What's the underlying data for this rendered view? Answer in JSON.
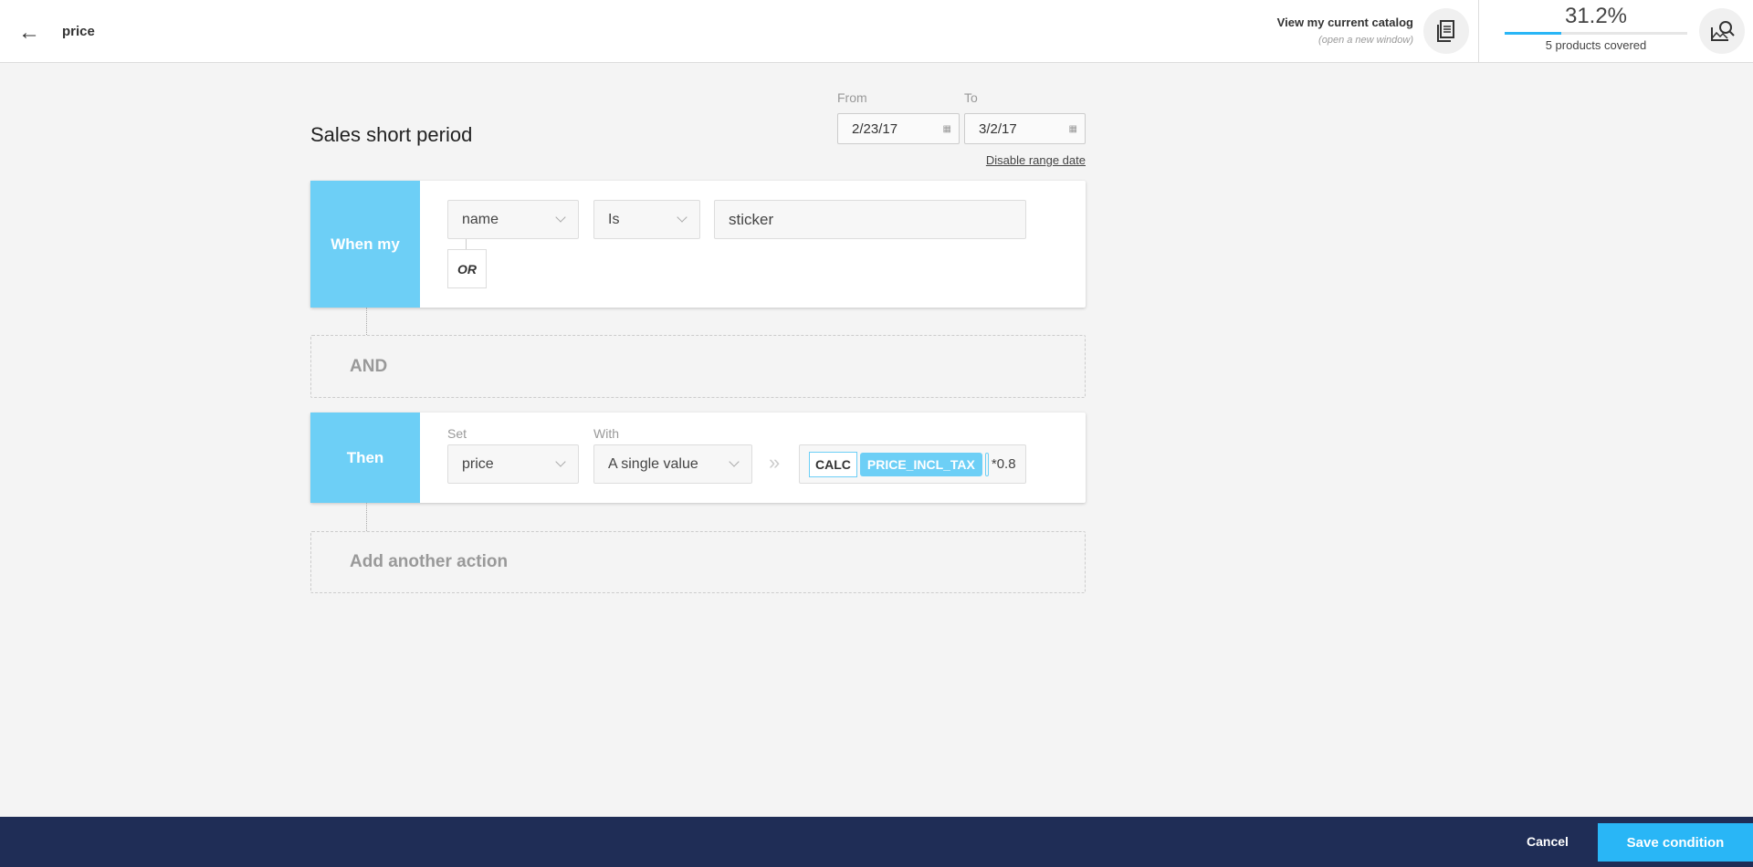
{
  "header": {
    "title": "price",
    "catalog_link": "View my current catalog",
    "catalog_sub": "(open a new window)",
    "coverage_percent": "31.2%",
    "coverage_fraction": 0.312,
    "coverage_text": "5 products covered",
    "icons": [
      "arrow-left-icon",
      "document-icon",
      "image-search-icon"
    ]
  },
  "main": {
    "title": "Sales short period",
    "from_label": "From",
    "to_label": "To",
    "from_value": "2/23/17",
    "to_value": "3/2/17",
    "disable_range": "Disable range date",
    "when": {
      "label": "When my",
      "field": "name",
      "operator": "Is",
      "value": "sticker",
      "or_label": "OR"
    },
    "and_label": "AND",
    "then": {
      "label": "Then",
      "set_label": "Set",
      "set_value": "price",
      "with_label": "With",
      "with_value": "A single value",
      "calc_tag": "CALC",
      "variable_tag": "PRICE_INCL_TAX",
      "expression": "*0.8"
    },
    "add_action": "Add another action"
  },
  "footer": {
    "cancel": "Cancel",
    "save": "Save condition"
  },
  "colors": {
    "accent": "#6dcff6",
    "footer": "#1f2d56",
    "save": "#29b6f6"
  }
}
